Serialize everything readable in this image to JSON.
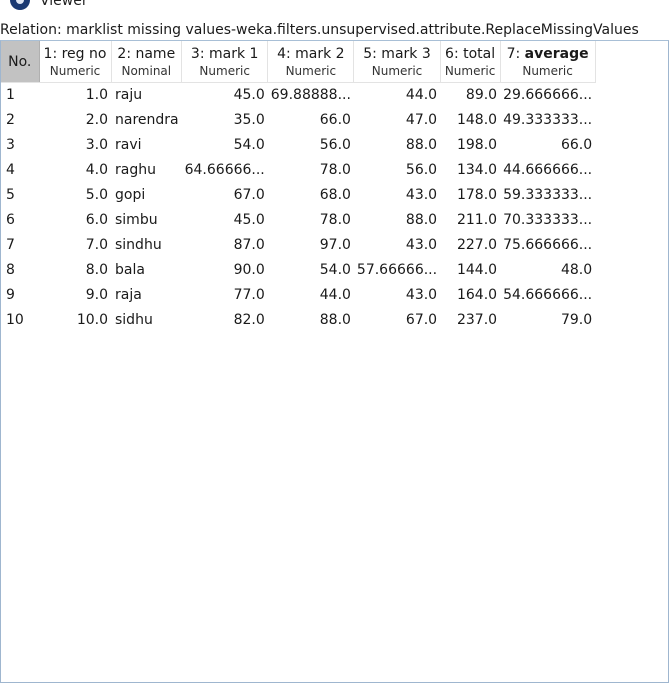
{
  "window": {
    "title": "Viewer"
  },
  "relation_label": "Relation: marklist missing values-weka.filters.unsupervised.attribute.ReplaceMissingValues",
  "table": {
    "columns": [
      {
        "name": "No.",
        "type": ""
      },
      {
        "name": "1: reg no",
        "type": "Numeric"
      },
      {
        "name": "2: name",
        "type": "Nominal"
      },
      {
        "name": "3: mark 1",
        "type": "Numeric"
      },
      {
        "name": "4: mark 2",
        "type": "Numeric"
      },
      {
        "name": "5: mark 3",
        "type": "Numeric"
      },
      {
        "name": "6: total",
        "type": "Numeric"
      },
      {
        "name_prefix": "7: ",
        "name_bold": "average",
        "type": "Numeric"
      }
    ],
    "rows": [
      [
        "1",
        "1.0",
        "raju",
        "45.0",
        "69.88888...",
        "44.0",
        "89.0",
        "29.666666..."
      ],
      [
        "2",
        "2.0",
        "narendra",
        "35.0",
        "66.0",
        "47.0",
        "148.0",
        "49.333333..."
      ],
      [
        "3",
        "3.0",
        "ravi",
        "54.0",
        "56.0",
        "88.0",
        "198.0",
        "66.0"
      ],
      [
        "4",
        "4.0",
        "raghu",
        "64.66666...",
        "78.0",
        "56.0",
        "134.0",
        "44.666666..."
      ],
      [
        "5",
        "5.0",
        "gopi",
        "67.0",
        "68.0",
        "43.0",
        "178.0",
        "59.333333..."
      ],
      [
        "6",
        "6.0",
        "simbu",
        "45.0",
        "78.0",
        "88.0",
        "211.0",
        "70.333333..."
      ],
      [
        "7",
        "7.0",
        "sindhu",
        "87.0",
        "97.0",
        "43.0",
        "227.0",
        "75.666666..."
      ],
      [
        "8",
        "8.0",
        "bala",
        "90.0",
        "54.0",
        "57.66666...",
        "144.0",
        "48.0"
      ],
      [
        "9",
        "9.0",
        "raja",
        "77.0",
        "44.0",
        "43.0",
        "164.0",
        "54.666666..."
      ],
      [
        "10",
        "10.0",
        "sidhu",
        "82.0",
        "88.0",
        "67.0",
        "237.0",
        "79.0"
      ]
    ]
  }
}
